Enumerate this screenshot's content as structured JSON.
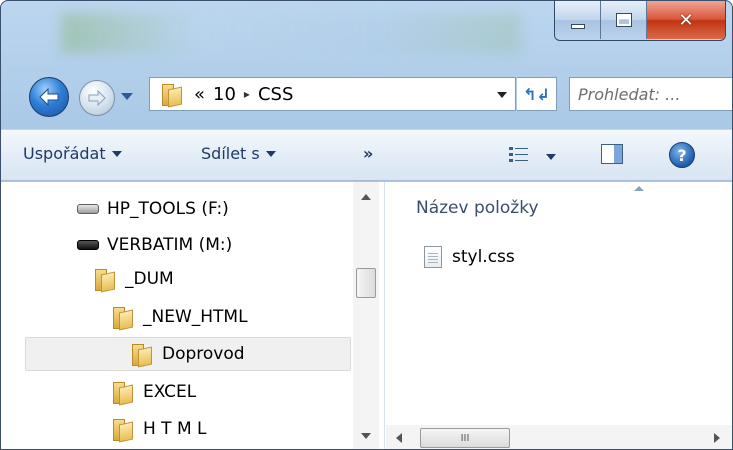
{
  "address": {
    "overflow": "«",
    "segment_1": "10",
    "separator": "▸",
    "segment_2": "CSS"
  },
  "search": {
    "placeholder": "Prohledat: ..."
  },
  "toolbar": {
    "organize_label": "Uspořádat",
    "share_label": "Sdílet s",
    "more_label": "»",
    "help_label": "?"
  },
  "nav_tree": [
    {
      "label": "HP_TOOLS (F:)",
      "icon": "drive-icon"
    },
    {
      "label": "VERBATIM (M:)",
      "icon": "usb-drive-icon"
    },
    {
      "label": "_DUM",
      "icon": "folder-icon"
    },
    {
      "label": "_NEW_HTML",
      "icon": "folder-icon"
    },
    {
      "label": "Doprovod",
      "icon": "folder-icon",
      "selected": true
    },
    {
      "label": "EXCEL",
      "icon": "folder-icon"
    },
    {
      "label": "H T M L",
      "icon": "folder-icon"
    }
  ],
  "file_list": {
    "column_header": "Název položky",
    "files": [
      {
        "name": "styl.css",
        "icon": "text-file-icon"
      }
    ]
  },
  "scrollbar": {
    "thumb_grip": "III"
  },
  "colors": {
    "close_button": "#c03513",
    "accent": "#2f7fd6",
    "toolbar_text": "#1e3b66"
  }
}
